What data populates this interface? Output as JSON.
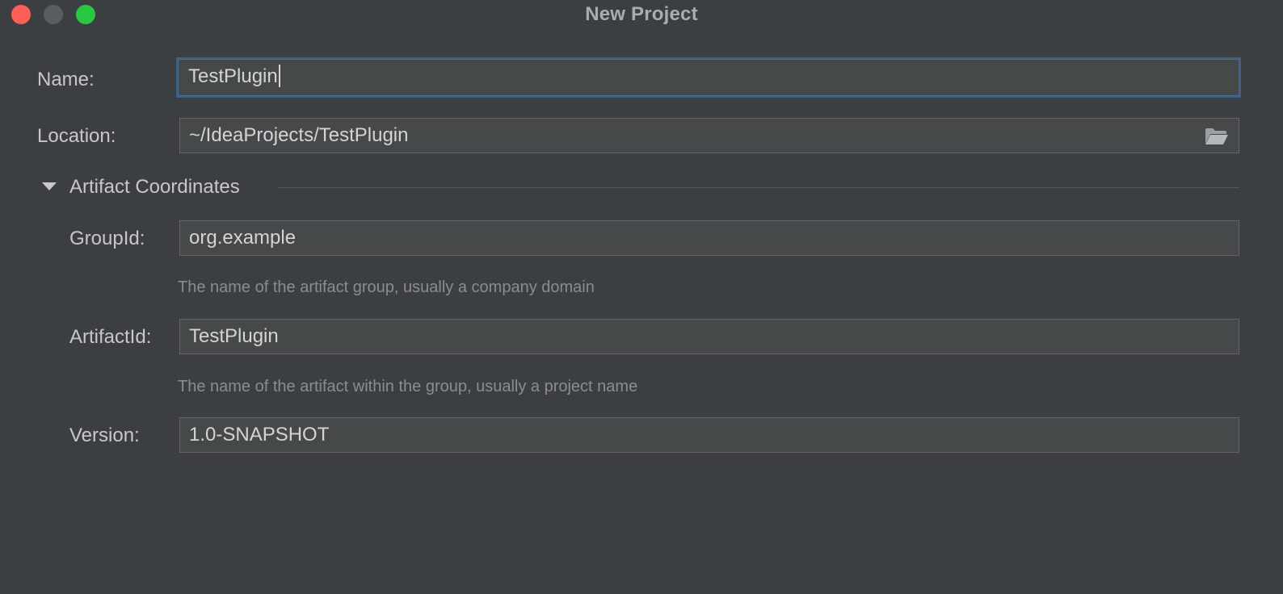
{
  "window": {
    "title": "New Project"
  },
  "form": {
    "name": {
      "label": "Name:",
      "value": "TestPlugin"
    },
    "location": {
      "label": "Location:",
      "value": "~/IdeaProjects/TestPlugin",
      "icon": "folder-icon"
    },
    "artifact_section": {
      "label": "Artifact Coordinates",
      "expanded": true,
      "group_id": {
        "label": "GroupId:",
        "value": "org.example",
        "hint": "The name of the artifact group, usually a company domain"
      },
      "artifact_id": {
        "label": "ArtifactId:",
        "value": "TestPlugin",
        "hint": "The name of the artifact within the group, usually a project name"
      },
      "version": {
        "label": "Version:",
        "value": "1.0-SNAPSHOT"
      }
    }
  },
  "colors": {
    "background": "#3c3f41",
    "field_background": "#45494a",
    "focus_border": "#3d6185",
    "close": "#fe5f57",
    "minimize": "#5a5d60",
    "maximize": "#28c840"
  }
}
